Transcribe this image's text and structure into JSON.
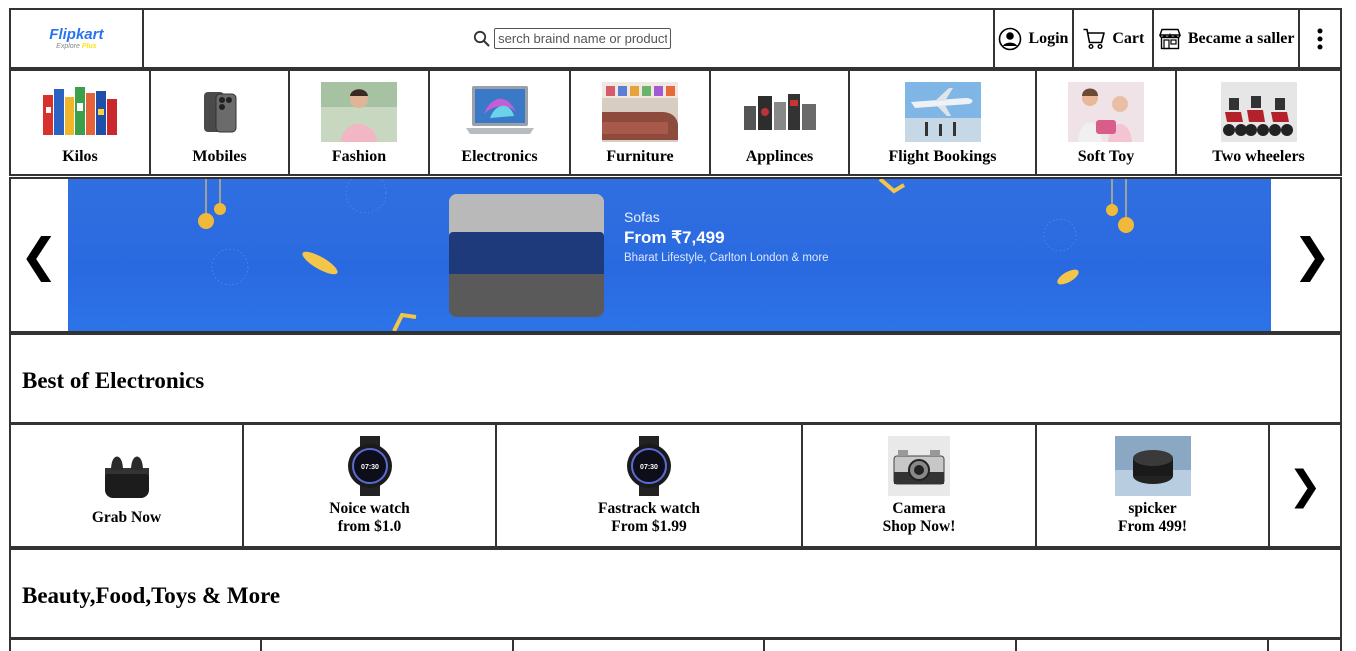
{
  "header": {
    "logo": {
      "brand": "Flipkart",
      "tagline": "Explore",
      "tagline_plus": "Plus"
    },
    "search": {
      "placeholder": "serch braind name or product"
    },
    "login_label": "Login",
    "cart_label": "Cart",
    "seller_label": "Became a saller"
  },
  "categories": [
    {
      "label": "Kilos",
      "icon": "grocery-image"
    },
    {
      "label": "Mobiles",
      "icon": "phone-image"
    },
    {
      "label": "Fashion",
      "icon": "fashion-image"
    },
    {
      "label": "Electronics",
      "icon": "laptop-image"
    },
    {
      "label": "Furniture",
      "icon": "sofa-image"
    },
    {
      "label": "Applinces",
      "icon": "appliances-image"
    },
    {
      "label": "Flight Bookings",
      "icon": "airplane-image"
    },
    {
      "label": "Soft Toy",
      "icon": "toy-image"
    },
    {
      "label": "Two wheelers",
      "icon": "scooter-image"
    }
  ],
  "banner": {
    "title": "Sofas",
    "price": "From ₹7,499",
    "brands": "Bharat Lifestyle, Carlton London & more",
    "prev_arrow": "❮",
    "next_arrow": "❯"
  },
  "best_of_electronics": {
    "title": "Best of Electronics",
    "items": [
      {
        "line1": "Grab Now",
        "line2": "",
        "icon": "earbuds-image"
      },
      {
        "line1": "Noice watch",
        "line2": "from $1.0",
        "icon": "smartwatch-image"
      },
      {
        "line1": "Fastrack watch",
        "line2": "From $1.99",
        "icon": "smartwatch-image"
      },
      {
        "line1": "Camera",
        "line2": "Shop Now!",
        "icon": "camera-image"
      },
      {
        "line1": "spicker",
        "line2": "From 499!",
        "icon": "speaker-image"
      }
    ],
    "next_arrow": "❯",
    "watch_time": "07:30"
  },
  "beauty_section": {
    "title": "Beauty,Food,Toys & More"
  },
  "colors": {
    "brand_blue": "#2874f0",
    "brand_yellow": "#ffe11b",
    "border": "#333333",
    "banner_bg": "#2f6fe0"
  }
}
